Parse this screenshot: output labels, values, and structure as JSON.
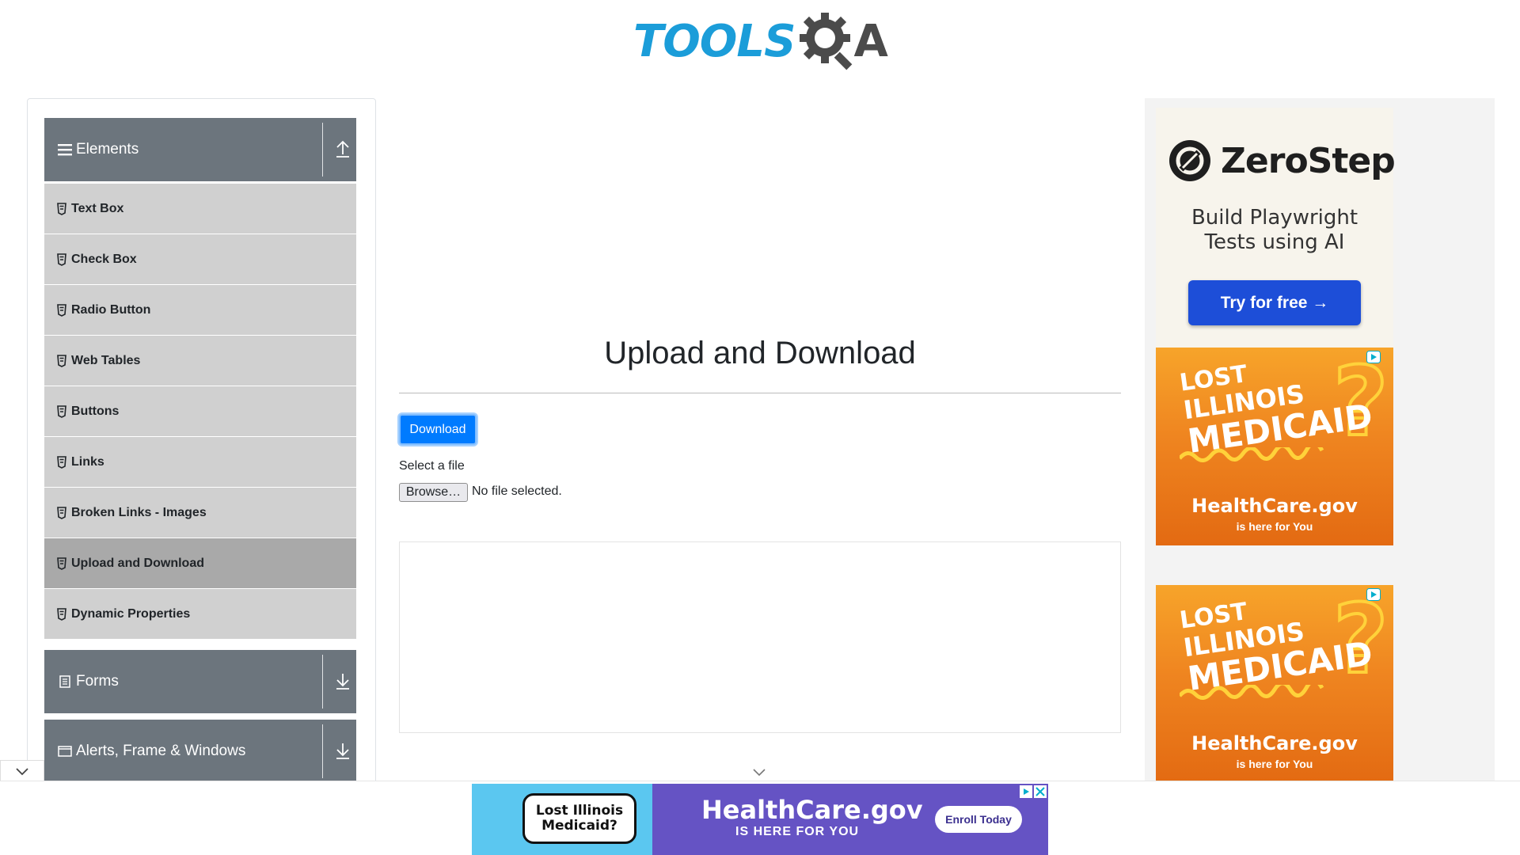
{
  "header": {
    "logo_text": "TOOLS",
    "logo_suffix": "A"
  },
  "sidebar": {
    "groups": [
      {
        "label": "Elements",
        "icon": "hamburger-icon",
        "expanded": true
      },
      {
        "label": "Forms",
        "icon": "document-icon",
        "expanded": false
      },
      {
        "label": "Alerts, Frame & Windows",
        "icon": "window-icon",
        "expanded": false
      }
    ],
    "items": [
      {
        "label": "Text Box"
      },
      {
        "label": "Check Box"
      },
      {
        "label": "Radio Button"
      },
      {
        "label": "Web Tables"
      },
      {
        "label": "Buttons"
      },
      {
        "label": "Links"
      },
      {
        "label": "Broken Links - Images"
      },
      {
        "label": "Upload and Download",
        "active": true
      },
      {
        "label": "Dynamic Properties"
      }
    ]
  },
  "main": {
    "title": "Upload and Download",
    "download_label": "Download",
    "select_label": "Select a file",
    "browse_label": "Browse…",
    "no_file_text": "No file selected."
  },
  "ads": {
    "zerostep": {
      "name": "ZeroStep",
      "tagline_1": "Build Playwright",
      "tagline_2": "Tests using AI",
      "button": "Try for free →"
    },
    "medicaid": {
      "line1": "LOST",
      "line2": "ILLINOIS",
      "line3": "MEDICAID",
      "brand": "HealthCare.gov",
      "sub": "is here for You"
    },
    "banner": {
      "speech": "Lost Illinois Medicaid?",
      "brand": "HealthCare.gov",
      "sub": "IS HERE FOR YOU",
      "button": "Enroll Today"
    }
  },
  "colors": {
    "accent": "#007bff",
    "sidebar_header": "#6c757d",
    "sidebar_item": "#d0d0d0",
    "sidebar_active": "#a9a9a9",
    "logo_blue": "#1b9dd9"
  }
}
